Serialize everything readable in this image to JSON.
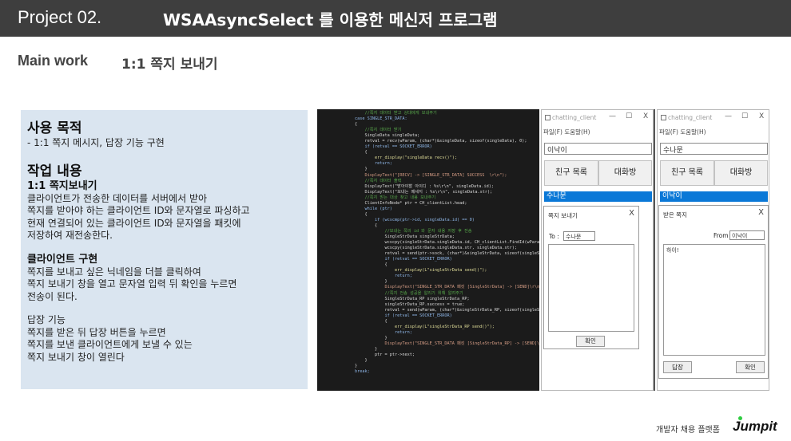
{
  "header": {
    "project": "Project  02.",
    "title": "WSAAsyncSelect 를 이용한 메신저 프로그램"
  },
  "section": {
    "main_work": "Main work",
    "subtitle": "1:1 쪽지 보내기"
  },
  "description": {
    "purpose_heading": "사용 목적",
    "purpose_item": "-  1:1 쪽지 메시지, 답장 기능 구현",
    "work_heading": "작업 내용",
    "work_sub1": "1:1 쪽지보내기",
    "work_sub1_lines": [
      "클라이언트가 전송한 데이터를 서버에서 받아",
      "쪽지를 받아야 하는 클라이언트 ID와 문자열로 파싱하고",
      "현재 연결되어 있는 클라이언트 ID와 문자열을 패킷에",
      "저장하여 재전송한다."
    ],
    "client_heading": "클라이언트 구현",
    "client_lines": [
      "쪽지를 보내고 싶은 닉네임을 더블 클릭하여",
      "쪽지 보내기 창을 열고 문자열 입력 뒤 확인을 누르면",
      "전송이 된다."
    ],
    "reply_lines": [
      "답장 기능",
      "쪽지를 받은 뒤 답장 버튼을 누르면",
      "쪽지를 보낸 클라이언트에게 보낼 수 있는",
      "쪽지 보내기 창이 열린다"
    ]
  },
  "code_lines": [
    {
      "t": "            //쪽지 데이터 받고 상대에게 보내주기",
      "c": "cm"
    },
    {
      "t": "        case SINGLE_STR_DATA:",
      "c": "kw"
    },
    {
      "t": "        {",
      "c": ""
    },
    {
      "t": "            //쪽지 데이터 받기",
      "c": "cm"
    },
    {
      "t": "            SingleData singleData;",
      "c": ""
    },
    {
      "t": "            retval = recv(wParam, (char*)&singleData, sizeof(singleData), 0);",
      "c": ""
    },
    {
      "t": "            if (retval == SOCKET_ERROR)",
      "c": "kw"
    },
    {
      "t": "            {",
      "c": ""
    },
    {
      "t": "                err_display(\"singleData recv()\");",
      "c": "fn"
    },
    {
      "t": "                return;",
      "c": "kw"
    },
    {
      "t": "            }",
      "c": ""
    },
    {
      "t": "            DisplayText(\"[RECV] -> [SINGLE_STR_DATA] SUCCESS  \\r\\n\");",
      "c": "st"
    },
    {
      "t": "",
      "c": ""
    },
    {
      "t": "            //쪽지 데이터 출력",
      "c": "cm"
    },
    {
      "t": "            DisplayText(\"받아야할 아이디 : %s\\r\\n\", singleData.id);",
      "c": ""
    },
    {
      "t": "            DisplayText(\"보내는 메세지 : %s\\r\\n\", singleData.str);",
      "c": ""
    },
    {
      "t": "",
      "c": ""
    },
    {
      "t": "            //쪽지 받는 대상 찾고 내용 보내주기",
      "c": "cm"
    },
    {
      "t": "            ClientInfoNode* ptr = CH_clientList.head;",
      "c": ""
    },
    {
      "t": "            while (ptr)",
      "c": "kw"
    },
    {
      "t": "            {",
      "c": ""
    },
    {
      "t": "                if (wcscmp(ptr->id, singleData.id) == 0)",
      "c": "kw"
    },
    {
      "t": "                {",
      "c": ""
    },
    {
      "t": "                    //보내는 쪽의 id 와 문자 내용 저장 후 전송",
      "c": "cm"
    },
    {
      "t": "                    SingleStrData singleStrData;",
      "c": ""
    },
    {
      "t": "                    wcscpy(singleStrData.singleData.id, CH_clientList.FindId(wParam));",
      "c": ""
    },
    {
      "t": "                    wcscpy(singleStrData.singleData.str, singleData.str);",
      "c": ""
    },
    {
      "t": "                    retval = send(ptr->sock, (char*)&singleStrData, sizeof(singleStrData), 0);",
      "c": ""
    },
    {
      "t": "                    if (retval == SOCKET_ERROR)",
      "c": "kw"
    },
    {
      "t": "                    {",
      "c": ""
    },
    {
      "t": "                        err_display(L\"singleStrData send()\");",
      "c": "fn"
    },
    {
      "t": "                        return;",
      "c": "kw"
    },
    {
      "t": "                    }",
      "c": ""
    },
    {
      "t": "",
      "c": ""
    },
    {
      "t": "                    DisplayText(\"SINGLE_STR_DATA 패킷 [SingleStrData] -> [SEND]\\r\\n\");",
      "c": "st"
    },
    {
      "t": "                    //쪽지 전송 성공을 알리기 위해 알려주기",
      "c": "cm"
    },
    {
      "t": "                    SingleStrData_RP singleStrData_RP;",
      "c": ""
    },
    {
      "t": "                    singleStrData_RP.success = true;",
      "c": ""
    },
    {
      "t": "                    retval = send(wParam, (char*)&singleStrData_RP, sizeof(singleStrData_RP), 0);",
      "c": ""
    },
    {
      "t": "                    if (retval == SOCKET_ERROR)",
      "c": "kw"
    },
    {
      "t": "                    {",
      "c": ""
    },
    {
      "t": "                        err_display(L\"singleStrData_RP send()\");",
      "c": "fn"
    },
    {
      "t": "                        return;",
      "c": "kw"
    },
    {
      "t": "                    }",
      "c": ""
    },
    {
      "t": "                    DisplayText(\"SINGLE_STR_DATA 패킷 [SingleStrData_RP] -> [SEND]\\r\\n\");",
      "c": "st"
    },
    {
      "t": "                }",
      "c": ""
    },
    {
      "t": "                ptr = ptr->next;",
      "c": ""
    },
    {
      "t": "            }",
      "c": ""
    },
    {
      "t": "        }",
      "c": ""
    },
    {
      "t": "        break;",
      "c": "kw"
    }
  ],
  "window1": {
    "title": "chatting_client",
    "min": "—",
    "max": "☐",
    "close": "X",
    "menu": "파일(F)   도움말(H)",
    "nickname": "이낙이",
    "friends_button": "친구 목록",
    "chatroom_button": "대화방",
    "selected_friend": "수나문",
    "dialog": {
      "title": "쪽지 보내기",
      "close": "X",
      "to_label": "To :",
      "to_value": "수나문",
      "ok_button": "확인"
    }
  },
  "window2": {
    "title": "chatting_client",
    "min": "—",
    "max": "☐",
    "close": "X",
    "menu": "파일(F)   도움말(H)",
    "nickname": "수나문",
    "friends_button": "친구 목록",
    "chatroom_button": "대화방",
    "selected_friend": "이낙이",
    "dialog": {
      "title": "받은 쪽지",
      "close": "X",
      "from_label": "From :",
      "from_value": "이낙이",
      "message": "하이!",
      "reply_button": "답장",
      "ok_button": "확인"
    }
  },
  "footer": {
    "platform_text": "개발자 채용 플랫폼",
    "brand": "Jumpit",
    "brand_color": "#2ecc40"
  }
}
